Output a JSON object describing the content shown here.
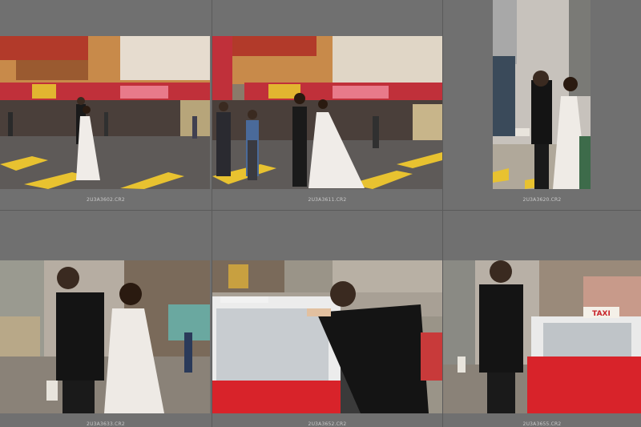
{
  "app": {
    "view": "grid"
  },
  "thumbnails": [
    {
      "filename": "2U3A3602.CR2",
      "scene": "street-crossing-couple-walking"
    },
    {
      "filename": "2U3A3611.CR2",
      "scene": "street-crossing-couple-walking-wide"
    },
    {
      "filename": "2U3A3620.CR2",
      "scene": "couple-street-portrait-vertical"
    },
    {
      "filename": "2U3A3633.CR2",
      "scene": "couple-holding-hands-laughing"
    },
    {
      "filename": "2U3A3652.CR2",
      "scene": "man-leaning-on-red-taxi"
    },
    {
      "filename": "2U3A3655.CR2",
      "scene": "man-walking-beside-red-taxi",
      "taxi_sign": "TAXI"
    }
  ],
  "colors": {
    "background": "#6f6f6f",
    "taxi_red": "#d8232a",
    "filename_text": "#c9c9c9"
  }
}
